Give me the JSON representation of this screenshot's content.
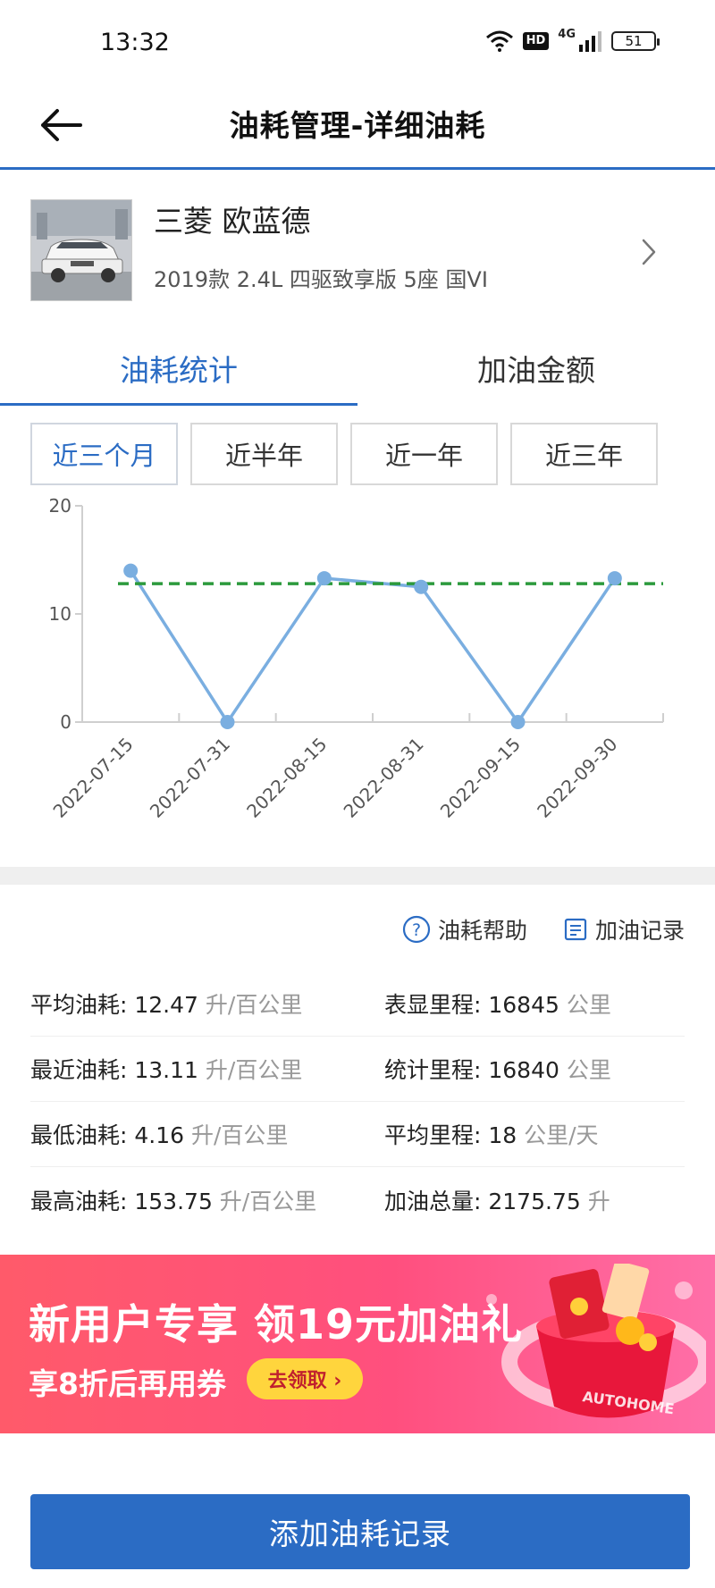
{
  "status_bar": {
    "time": "13:32",
    "hd": "HD",
    "network": "4G",
    "battery": "51"
  },
  "header": {
    "title": "油耗管理-详细油耗"
  },
  "car": {
    "name": "三菱 欧蓝德",
    "model": "2019款 2.4L 四驱致享版 5座 国VI"
  },
  "tabs": [
    {
      "label": "油耗统计",
      "active": true
    },
    {
      "label": "加油金额",
      "active": false
    }
  ],
  "ranges": [
    {
      "label": "近三个月",
      "active": true
    },
    {
      "label": "近半年",
      "active": false
    },
    {
      "label": "近一年",
      "active": false
    },
    {
      "label": "近三年",
      "active": false
    }
  ],
  "chart_data": {
    "type": "line",
    "categories": [
      "2022-07-15",
      "2022-07-31",
      "2022-08-15",
      "2022-08-31",
      "2022-09-15",
      "2022-09-30"
    ],
    "values": [
      14.0,
      0,
      13.3,
      12.5,
      0,
      13.3
    ],
    "average_line": 12.8,
    "yticks": [
      "0",
      "10",
      "20"
    ],
    "ylim": [
      0,
      20
    ],
    "line_color": "#7aaee0",
    "average_color": "#2c9a3c",
    "grid": false
  },
  "help": {
    "help_label": "油耗帮助",
    "records_label": "加油记录"
  },
  "stats": [
    [
      {
        "label": "平均油耗: ",
        "value": "12.47",
        "unit": " 升/百公里"
      },
      {
        "label": "表显里程: ",
        "value": "16845",
        "unit": " 公里"
      }
    ],
    [
      {
        "label": "最近油耗: ",
        "value": "13.11",
        "unit": " 升/百公里"
      },
      {
        "label": "统计里程: ",
        "value": "16840",
        "unit": " 公里"
      }
    ],
    [
      {
        "label": "最低油耗: ",
        "value": "4.16",
        "unit": " 升/百公里"
      },
      {
        "label": "平均里程: ",
        "value": "18",
        "unit": " 公里/天"
      }
    ],
    [
      {
        "label": "最高油耗: ",
        "value": "153.75",
        "unit": " 升/百公里"
      },
      {
        "label": "加油总量: ",
        "value": "2175.75",
        "unit": " 升"
      }
    ]
  ],
  "banner": {
    "title": "新用户专享 领19元加油礼",
    "subtitle": "享8折后再用券",
    "button": "去领取 ›",
    "ring_text": "AUTOHOME"
  },
  "bottom": {
    "add_label": "添加油耗记录"
  },
  "colors": {
    "accent": "#2b6cc4",
    "banner_red": "#ff4f7e",
    "banner_button": "#ffd53d"
  }
}
